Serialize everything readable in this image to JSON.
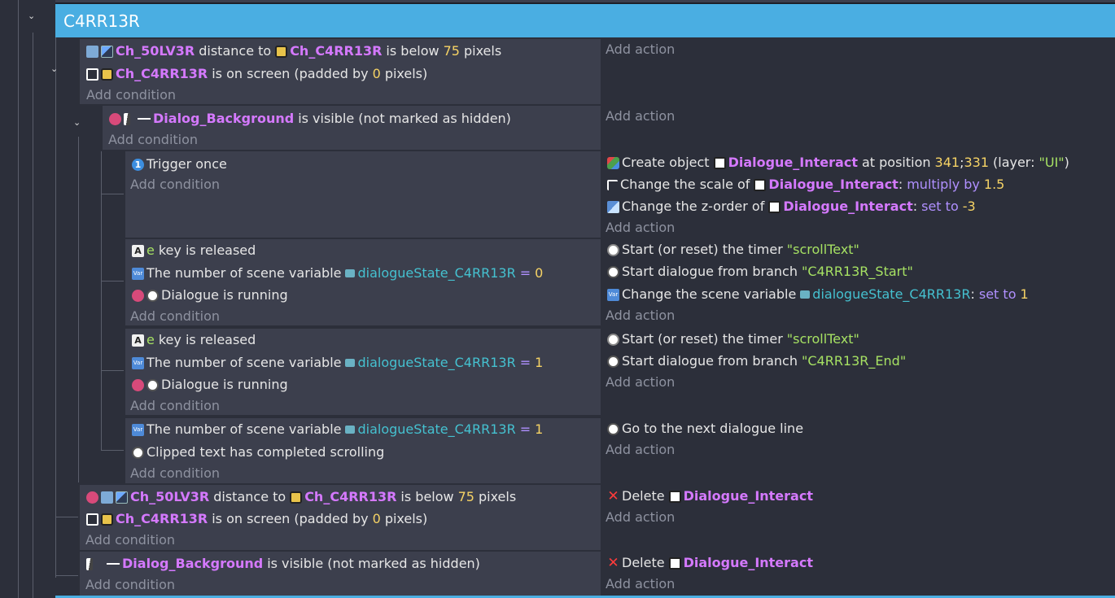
{
  "group": {
    "title": "C4RR13R"
  },
  "events": {
    "e1": {
      "c1": {
        "obj1": "Ch_50LV3R",
        "t1": "distance to",
        "obj2": "Ch_C4RR13R",
        "t2": "is below",
        "num": "75",
        "t3": "pixels"
      },
      "c2": {
        "obj": "Ch_C4RR13R",
        "t1": "is on screen (padded by",
        "num": "0",
        "t2": "pixels)"
      },
      "add_condition": "Add condition",
      "add_action": "Add action"
    },
    "e2": {
      "c1": {
        "obj": "Dialog_Background",
        "t": "is visible (not marked as hidden)"
      },
      "add_condition": "Add condition",
      "add_action": "Add action"
    },
    "e3": {
      "c1": {
        "t": "Trigger once"
      },
      "a1": {
        "t1": "Create object",
        "obj": "Dialogue_Interact",
        "t2": "at position",
        "x": "341",
        "sep": ";",
        "y": "331",
        "t3": "(layer:",
        "layer": "\"UI\"",
        "t4": ")"
      },
      "a2": {
        "t1": "Change the scale of",
        "obj": "Dialogue_Interact",
        "t2": ":",
        "op": "multiply by",
        "num": "1.5"
      },
      "a3": {
        "t1": "Change the z-order of",
        "obj": "Dialogue_Interact",
        "t2": ":",
        "op": "set to",
        "num": "-3"
      },
      "add_condition": "Add condition",
      "add_action": "Add action"
    },
    "e4": {
      "c1": {
        "key": "e",
        "t": "key is released"
      },
      "c2": {
        "t": "The number of scene variable",
        "var": "dialogueState_C4RR13R",
        "op": "=",
        "num": "0"
      },
      "c3": {
        "t": "Dialogue is running"
      },
      "a1": {
        "t": "Start (or reset) the timer",
        "str": "\"scrollText\""
      },
      "a2": {
        "t": "Start dialogue from branch",
        "str": "\"C4RR13R_Start\""
      },
      "a3": {
        "t": "Change the scene variable",
        "var": "dialogueState_C4RR13R",
        "t2": ":",
        "op": "set to",
        "num": "1"
      },
      "add_condition": "Add condition",
      "add_action": "Add action"
    },
    "e5": {
      "c1": {
        "key": "e",
        "t": "key is released"
      },
      "c2": {
        "t": "The number of scene variable",
        "var": "dialogueState_C4RR13R",
        "op": "=",
        "num": "1"
      },
      "c3": {
        "t": "Dialogue is running"
      },
      "a1": {
        "t": "Start (or reset) the timer",
        "str": "\"scrollText\""
      },
      "a2": {
        "t": "Start dialogue from branch",
        "str": "\"C4RR13R_End\""
      },
      "add_condition": "Add condition",
      "add_action": "Add action"
    },
    "e6": {
      "c1": {
        "t": "The number of scene variable",
        "var": "dialogueState_C4RR13R",
        "op": "=",
        "num": "1"
      },
      "c2": {
        "t": "Clipped text has completed scrolling"
      },
      "a1": {
        "t": "Go to the next dialogue line"
      },
      "add_condition": "Add condition",
      "add_action": "Add action"
    },
    "e7": {
      "c1": {
        "obj1": "Ch_50LV3R",
        "t1": "distance to",
        "obj2": "Ch_C4RR13R",
        "t2": "is below",
        "num": "75",
        "t3": "pixels"
      },
      "c2": {
        "obj": "Ch_C4RR13R",
        "t1": "is on screen (padded by",
        "num": "0",
        "t2": "pixels)"
      },
      "a1": {
        "t": "Delete",
        "obj": "Dialogue_Interact"
      },
      "add_condition": "Add condition",
      "add_action": "Add action"
    },
    "e8": {
      "c1": {
        "obj": "Dialog_Background",
        "t": "is visible (not marked as hidden)"
      },
      "a1": {
        "t": "Delete",
        "obj": "Dialogue_Interact"
      },
      "add_condition": "Add condition",
      "add_action": "Add action"
    }
  }
}
